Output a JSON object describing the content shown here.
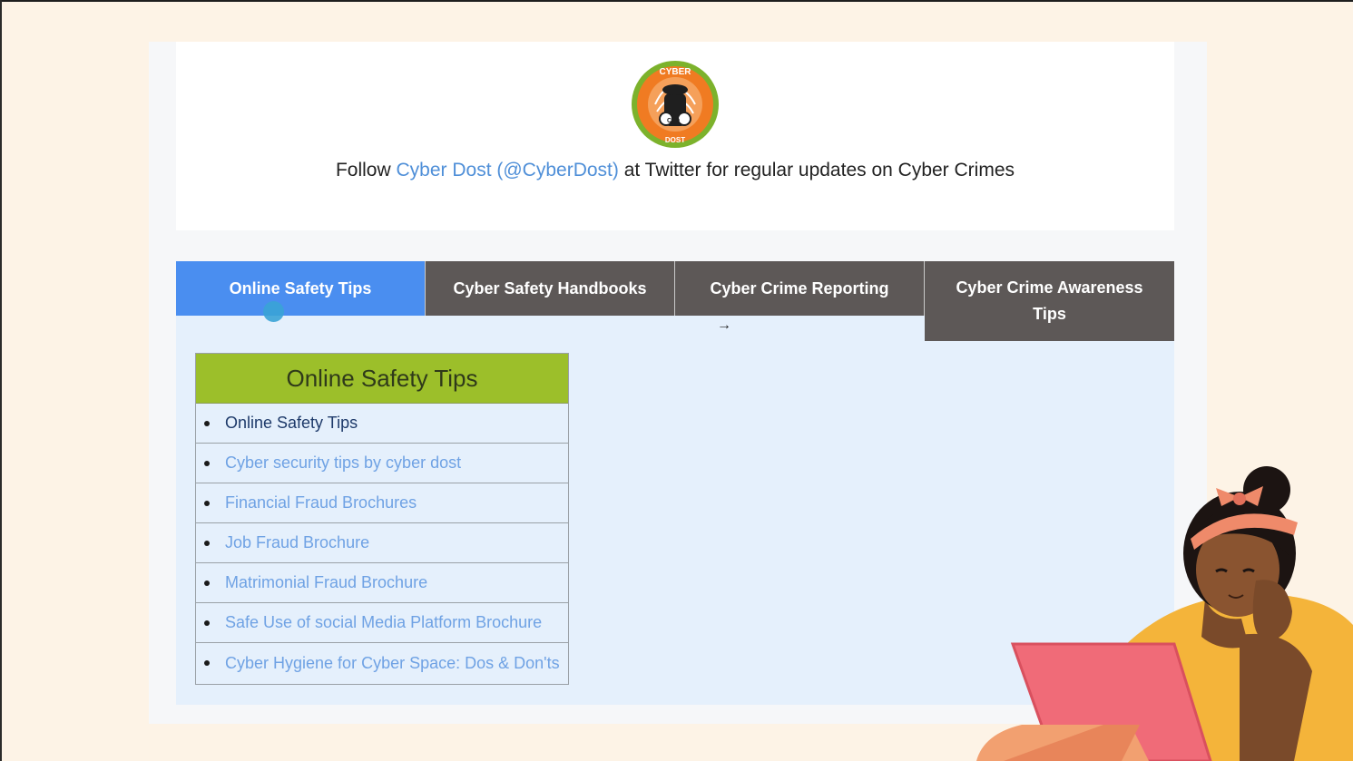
{
  "follow": {
    "prefix": "Follow ",
    "link_text": "Cyber Dost (@CyberDost)",
    "suffix": " at Twitter for regular updates on Cyber Crimes"
  },
  "logo": {
    "top_text": "CYBER",
    "bottom_text": "DOST",
    "initials": "CD"
  },
  "tabs": [
    {
      "label": "Online Safety Tips",
      "active": true
    },
    {
      "label": "Cyber Safety Handbooks",
      "active": false
    },
    {
      "label": "Cyber Crime Reporting",
      "active": false
    },
    {
      "label": "Cyber Crime Awareness Tips",
      "active": false
    }
  ],
  "panel": {
    "heading": "Online Safety Tips",
    "items": [
      "Online Safety Tips",
      "Cyber security tips by cyber dost",
      "Financial Fraud Brochures",
      "Job Fraud Brochure",
      "Matrimonial Fraud Brochure",
      "Safe Use of social Media Platform Brochure",
      "Cyber Hygiene for Cyber Space: Dos & Don'ts"
    ]
  },
  "cursor": {
    "icon": "arrow-right-icon",
    "glyph": "→"
  },
  "colors": {
    "active_tab": "#4a8ef0",
    "inactive_tab": "#5d5857",
    "list_header": "#9cbf2a",
    "link": "#6fa2e4",
    "page_background": "#fdf3e6"
  }
}
